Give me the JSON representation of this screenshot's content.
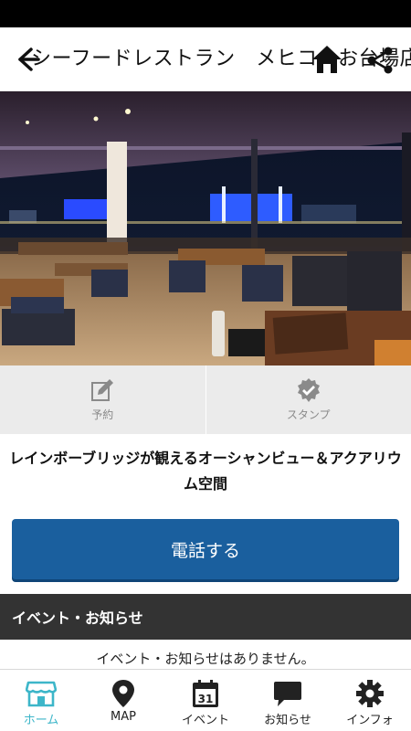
{
  "header": {
    "title": "シーフードレストラン　メヒコ　お台場店"
  },
  "hero": {
    "alt": "restaurant-interior-photo"
  },
  "actions": [
    {
      "label": "予約",
      "icon": "edit-icon"
    },
    {
      "label": "スタンプ",
      "icon": "stamp-check-icon"
    }
  ],
  "description": "レインボーブリッジが観えるオーシャンビュー＆アクアリウム空間",
  "call_button": "電話する",
  "events": {
    "heading": "イベント・お知らせ",
    "empty_text": "イベント・お知らせはありません。"
  },
  "tabbar": {
    "items": [
      {
        "label": "ホーム",
        "icon": "shop-icon",
        "active": true
      },
      {
        "label": "MAP",
        "icon": "map-pin-icon",
        "active": false
      },
      {
        "label": "イベント",
        "icon": "calendar-icon",
        "active": false
      },
      {
        "label": "お知らせ",
        "icon": "chat-bubble-icon",
        "active": false
      },
      {
        "label": "インフォ",
        "icon": "gear-icon",
        "active": false
      }
    ],
    "calendar_day": "31"
  },
  "colors": {
    "accent": "#3db6c9",
    "call_button": "#1a5f9e",
    "section_header": "#333333"
  }
}
